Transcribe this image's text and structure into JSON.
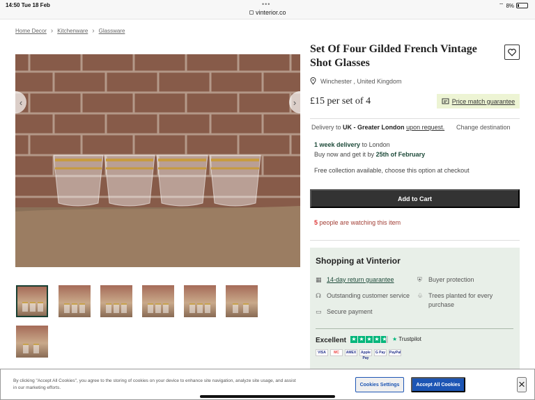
{
  "status_bar": {
    "time": "14:50",
    "date": "Tue 18 Feb",
    "url": "vinterior.co",
    "battery": "8%"
  },
  "breadcrumb": [
    "Home Decor",
    "Kitchenware",
    "Glassware"
  ],
  "product": {
    "title": "Set Of Four Gilded French Vintage Shot Glasses",
    "location": "Winchester , United Kingdom",
    "price": "£15",
    "price_suffix": "per set of 4",
    "price_match": "Price match guarantee"
  },
  "delivery": {
    "prefix": "Delivery to",
    "region": "UK - Greater London",
    "request": "upon request.",
    "change": "Change destination",
    "week_delivery": "1 week delivery",
    "to_london": "to London",
    "buy_now": "Buy now and get it by",
    "date": "25th of February",
    "collection": "Free collection available, choose this option at checkout"
  },
  "actions": {
    "add_to_cart": "Add to Cart"
  },
  "watching": {
    "count": "5",
    "text": "people are watching this item"
  },
  "shopping": {
    "title": "Shopping at Vinterior",
    "features": [
      {
        "label": "14-day return guarantee"
      },
      {
        "label": "Buyer protection"
      },
      {
        "label": "Outstanding customer service"
      },
      {
        "label": "Trees planted for every purchase"
      },
      {
        "label": "Secure payment"
      }
    ],
    "rating": "Excellent",
    "trustpilot": "Trustpilot",
    "payments": [
      "VISA",
      "MC",
      "AMEX",
      "Apple Pay",
      "G Pay",
      "PayPal"
    ]
  },
  "cookie": {
    "text_prefix": "By clicking \"Accept All Cookies\", you agree to the storing of cookies on your device to enhance site navigation, analyze site usage, and assist in our marketing efforts.",
    "settings": "Cookies Settings",
    "accept": "Accept All Cookies",
    "close": "×"
  },
  "icons": {
    "favourite": "heart-icon",
    "location": "pin-icon",
    "close": "close-icon"
  }
}
